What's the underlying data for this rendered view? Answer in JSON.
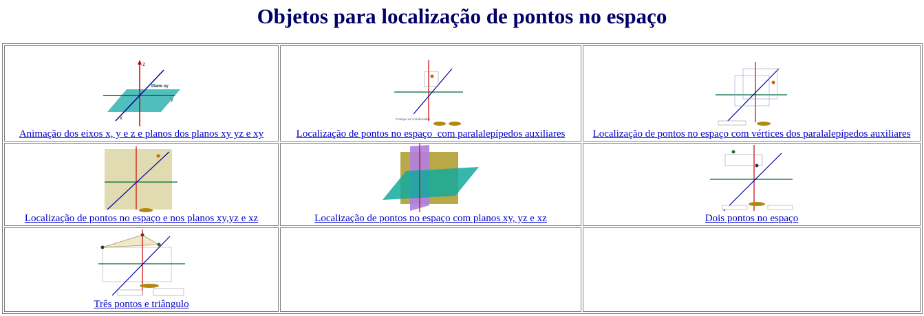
{
  "page": {
    "title": "Objetos para localização de pontos no espaço"
  },
  "cells": [
    {
      "label": "Animação dos eixos x, y e z e planos dos planos xy yz e xy ",
      "thumb_texts": {
        "z": "z",
        "y": "y",
        "x": "x",
        "plane": "Plano xy"
      }
    },
    {
      "label": "Localização de pontos no espaço_com paralalepípedos auxiliares",
      "thumb_texts": {
        "hint": "Coloque as coordenadas"
      }
    },
    {
      "label": "Localização de pontos no espaço com vértices dos paralalepípedos auxiliares"
    },
    {
      "label": "Localização de pontos no espaço e nos planos xy,yz e xz"
    },
    {
      "label": "Localização de pontos no espaço com planos xy, yz e xz"
    },
    {
      "label": "Dois pontos no espaço"
    },
    {
      "label": "Três pontos e triângulo"
    }
  ],
  "colors": {
    "title": "#000066",
    "link": "#0000cc",
    "z_axis": "#cc0000",
    "y_axis": "#006633",
    "x_axis": "#000099",
    "plane_xy": "#33b3b3"
  }
}
